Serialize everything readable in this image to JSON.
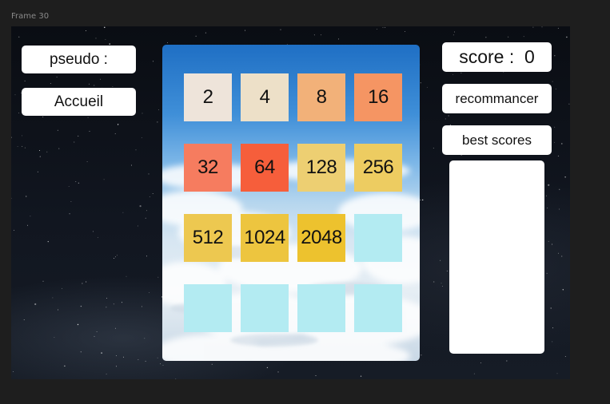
{
  "frame": {
    "label": "Frame 30"
  },
  "left_panel": {
    "pseudo_label": "pseudo :",
    "home_label": "Accueil"
  },
  "right_panel": {
    "score_label": "score :  0",
    "restart_label": "recommancer",
    "best_scores_label": "best scores"
  },
  "board": {
    "cells": [
      {
        "value": "2",
        "color": "#eee4da"
      },
      {
        "value": "4",
        "color": "#ede0c8"
      },
      {
        "value": "8",
        "color": "#f2b179"
      },
      {
        "value": "16",
        "color": "#f59563"
      },
      {
        "value": "32",
        "color": "#f67c5f"
      },
      {
        "value": "64",
        "color": "#f65e3b"
      },
      {
        "value": "128",
        "color": "#edcf72"
      },
      {
        "value": "256",
        "color": "#edcc61"
      },
      {
        "value": "512",
        "color": "#edc850"
      },
      {
        "value": "1024",
        "color": "#edc53f"
      },
      {
        "value": "2048",
        "color": "#edc22e"
      },
      {
        "value": "",
        "color": "#b3ebf2"
      },
      {
        "value": "",
        "color": "#b3ebf2"
      },
      {
        "value": "",
        "color": "#b3ebf2"
      },
      {
        "value": "",
        "color": "#b3ebf2"
      },
      {
        "value": "",
        "color": "#b3ebf2"
      }
    ]
  }
}
